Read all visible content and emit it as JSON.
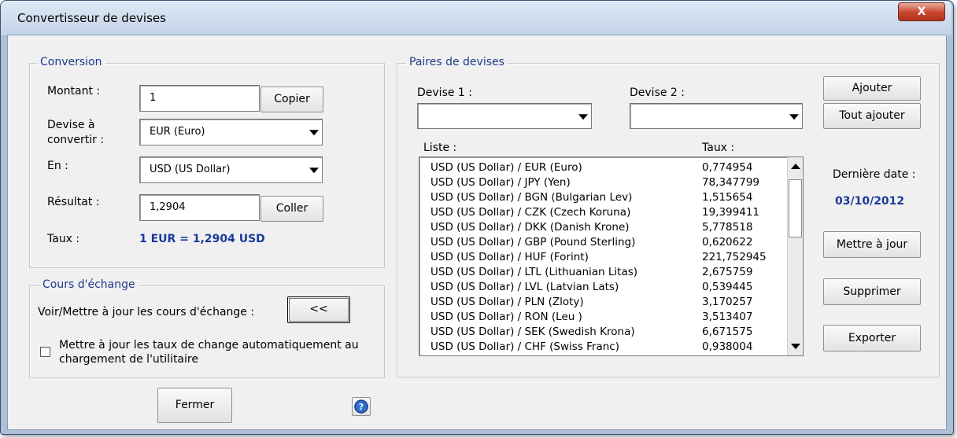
{
  "window": {
    "title": "Convertisseur de devises",
    "close_label": "X"
  },
  "conversion": {
    "legend": "Conversion",
    "amount_label": "Montant :",
    "amount_value": "1",
    "copy_button": "Copier",
    "from_label_line1": "Devise à",
    "from_label_line2": "convertir :",
    "from_value": "EUR (Euro)",
    "to_label": "En :",
    "to_value": "USD (US Dollar)",
    "result_label": "Résultat :",
    "result_value": "1,2904",
    "paste_button": "Coller",
    "rate_label": "Taux :",
    "rate_value": "1 EUR = 1,2904 USD"
  },
  "exchange": {
    "legend": "Cours d'échange",
    "view_label": "Voir/Mettre à jour les cours d'échange :",
    "toggle_button": "<<",
    "auto_update_line1": "Mettre à jour les taux de change automatiquement au",
    "auto_update_line2": "chargement de l'utilitaire",
    "auto_update_checked": false
  },
  "pairs": {
    "legend": "Paires de devises",
    "currency1_label": "Devise 1 :",
    "currency1_value": "",
    "currency2_label": "Devise 2 :",
    "currency2_value": "",
    "list_header": "Liste :",
    "rate_header": "Taux :",
    "rows": [
      {
        "pair": "USD (US Dollar) / EUR (Euro)",
        "rate": "0,774954"
      },
      {
        "pair": "USD (US Dollar) / JPY (Yen)",
        "rate": "78,347799"
      },
      {
        "pair": "USD (US Dollar) / BGN (Bulgarian Lev)",
        "rate": "1,515654"
      },
      {
        "pair": "USD (US Dollar) / CZK (Czech Koruna)",
        "rate": "19,399411"
      },
      {
        "pair": "USD (US Dollar) / DKK (Danish Krone)",
        "rate": "5,778518"
      },
      {
        "pair": "USD (US Dollar) / GBP (Pound Sterling)",
        "rate": "0,620622"
      },
      {
        "pair": "USD (US Dollar) / HUF (Forint)",
        "rate": "221,752945"
      },
      {
        "pair": "USD (US Dollar) / LTL (Lithuanian Litas)",
        "rate": "2,675759"
      },
      {
        "pair": "USD (US Dollar) / LVL (Latvian Lats)",
        "rate": "0,539445"
      },
      {
        "pair": "USD (US Dollar) / PLN (Zloty)",
        "rate": "3,170257"
      },
      {
        "pair": "USD (US Dollar) / RON (Leu  )",
        "rate": "3,513407"
      },
      {
        "pair": "USD (US Dollar) / SEK (Swedish Krona)",
        "rate": "6,671575"
      },
      {
        "pair": "USD (US Dollar) / CHF (Swiss Franc)",
        "rate": "0,938004"
      }
    ]
  },
  "actions": {
    "add": "Ajouter",
    "add_all": "Tout ajouter",
    "last_date_label": "Dernière date :",
    "last_date_value": "03/10/2012",
    "update": "Mettre à jour",
    "delete": "Supprimer",
    "export": "Exporter"
  },
  "footer": {
    "close_button": "Fermer",
    "help_icon": "help-icon"
  },
  "colors": {
    "accent_blue": "#1a3a9a",
    "legend_blue": "#1e3a8a",
    "close_red": "#c7452d"
  }
}
